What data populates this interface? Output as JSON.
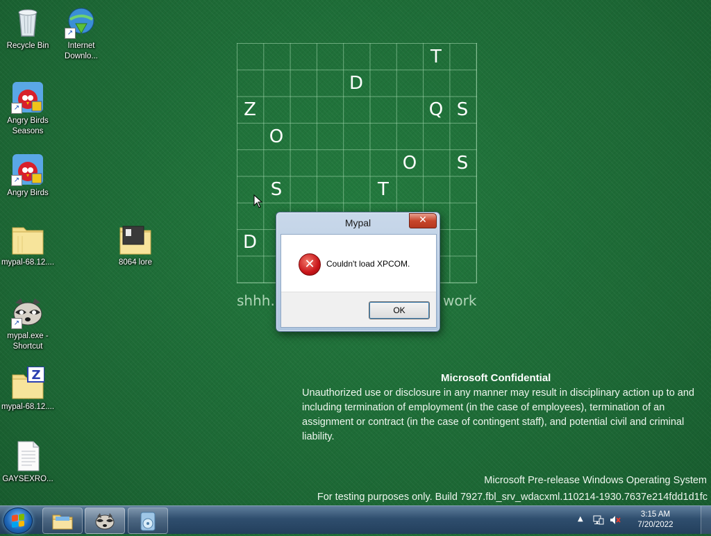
{
  "desktop": {
    "icons": [
      {
        "label": "Recycle Bin",
        "icon": "recycle-bin-icon"
      },
      {
        "label": "Internet Downlo...",
        "icon": "internet-download-manager-icon"
      },
      {
        "label": "Angry Birds Seasons",
        "icon": "angry-birds-seasons-icon"
      },
      {
        "label": "Angry Birds",
        "icon": "angry-birds-icon"
      },
      {
        "label": "mypal-68.12....",
        "icon": "folder-icon"
      },
      {
        "label": "8064 lore",
        "icon": "folder-icon"
      },
      {
        "label": "mypal.exe - Shortcut",
        "icon": "raccoon-icon"
      },
      {
        "label": "mypal-68.12....",
        "icon": "zip-folder-icon"
      },
      {
        "label": "GAYSEXRO...",
        "icon": "text-document-icon"
      }
    ]
  },
  "grid": {
    "letters": [
      "T",
      "D",
      "Z",
      "Q",
      "S",
      "O",
      "O",
      "S",
      "S",
      "T",
      "D"
    ],
    "caption_left": "shhh.",
    "caption_right": "work"
  },
  "dialog": {
    "title": "Mypal",
    "close_label": "✕",
    "message": "Couldn't load XPCOM.",
    "ok_label": "OK"
  },
  "watermark": {
    "title": "Microsoft Confidential",
    "body": "Unauthorized use or disclosure in any manner may result in disciplinary action up to and including termination of employment (in the case of employees), termination of an assignment or contract (in the case of contingent staff), and potential civil and criminal liability.",
    "os_line": "Microsoft Pre-release Windows Operating System",
    "build_line": "For testing purposes only. Build 7927.fbl_srv_wdacxml.110214-1930.7637e214fdd1d1fc"
  },
  "taskbar": {
    "pinned": [
      {
        "icon": "file-explorer-icon"
      },
      {
        "icon": "mypal-raccoon-icon"
      },
      {
        "icon": "windows-media-player-icon"
      }
    ],
    "tray": {
      "time": "3:15 AM",
      "date": "7/20/2022"
    }
  },
  "colors": {
    "desktop_bg": "#1e6b36",
    "taskbar": "#2f4e6e",
    "error_red": "#c9151a"
  }
}
